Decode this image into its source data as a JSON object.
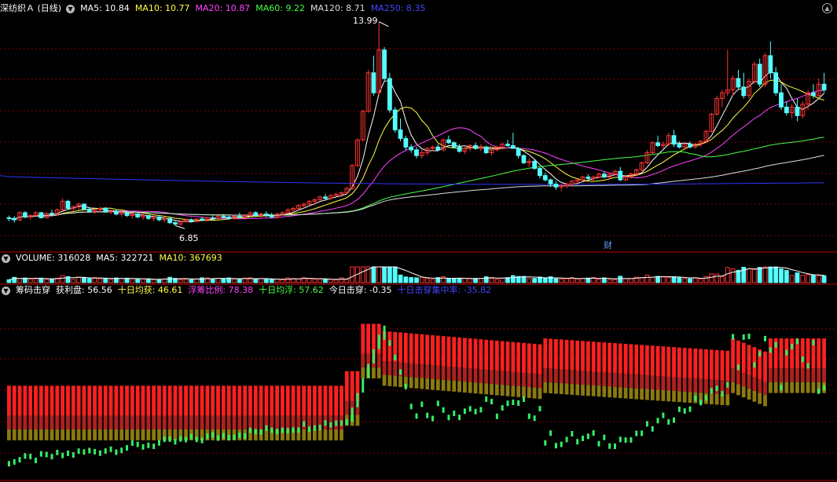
{
  "main": {
    "title": "深纺织Ａ (日线)",
    "ma": [
      {
        "label": "MA5: 10.84",
        "color": "#ffffff"
      },
      {
        "label": "MA10: 10.77",
        "color": "#ffff44"
      },
      {
        "label": "MA20: 10.87",
        "color": "#ff44ff"
      },
      {
        "label": "MA60: 9.22",
        "color": "#44ff44"
      },
      {
        "label": "MA120: 8.71",
        "color": "#dddddd"
      },
      {
        "label": "MA250: 8.35",
        "color": "#4444ff"
      }
    ],
    "high_label": "13.99",
    "low_label": "6.85",
    "finance_marker": "财",
    "candles": [
      [
        7.12,
        7.2,
        7.0,
        7.1
      ],
      [
        7.1,
        7.18,
        6.95,
        7.05
      ],
      [
        7.05,
        7.35,
        7.0,
        7.3
      ],
      [
        7.3,
        7.35,
        7.1,
        7.15
      ],
      [
        7.15,
        7.25,
        7.05,
        7.2
      ],
      [
        7.2,
        7.35,
        7.15,
        7.3
      ],
      [
        7.3,
        7.32,
        7.1,
        7.12
      ],
      [
        7.12,
        7.3,
        7.1,
        7.28
      ],
      [
        7.28,
        7.4,
        7.2,
        7.25
      ],
      [
        7.25,
        7.45,
        7.2,
        7.4
      ],
      [
        7.4,
        7.8,
        7.35,
        7.7
      ],
      [
        7.7,
        7.75,
        7.4,
        7.45
      ],
      [
        7.45,
        7.55,
        7.35,
        7.5
      ],
      [
        7.5,
        7.65,
        7.4,
        7.6
      ],
      [
        7.6,
        7.62,
        7.4,
        7.42
      ],
      [
        7.42,
        7.5,
        7.3,
        7.35
      ],
      [
        7.35,
        7.45,
        7.25,
        7.4
      ],
      [
        7.4,
        7.5,
        7.3,
        7.45
      ],
      [
        7.45,
        7.5,
        7.3,
        7.32
      ],
      [
        7.32,
        7.4,
        7.25,
        7.35
      ],
      [
        7.35,
        7.4,
        7.2,
        7.25
      ],
      [
        7.25,
        7.35,
        7.15,
        7.3
      ],
      [
        7.3,
        7.35,
        7.15,
        7.2
      ],
      [
        7.2,
        7.3,
        7.1,
        7.25
      ],
      [
        7.25,
        7.3,
        7.1,
        7.15
      ],
      [
        7.15,
        7.25,
        7.05,
        7.2
      ],
      [
        7.2,
        7.22,
        7.05,
        7.1
      ],
      [
        7.1,
        7.2,
        7.0,
        7.15
      ],
      [
        7.15,
        7.18,
        7.0,
        7.05
      ],
      [
        7.05,
        7.15,
        6.95,
        7.1
      ],
      [
        7.1,
        7.12,
        6.9,
        6.95
      ],
      [
        6.95,
        7.0,
        6.85,
        6.9
      ],
      [
        6.9,
        7.0,
        6.85,
        6.98
      ],
      [
        6.98,
        7.1,
        6.95,
        7.05
      ],
      [
        7.05,
        7.1,
        6.95,
        7.0
      ],
      [
        7.0,
        7.1,
        6.95,
        7.08
      ],
      [
        7.08,
        7.15,
        7.0,
        7.05
      ],
      [
        7.05,
        7.15,
        7.0,
        7.12
      ],
      [
        7.12,
        7.2,
        7.05,
        7.1
      ],
      [
        7.1,
        7.2,
        7.05,
        7.18
      ],
      [
        7.18,
        7.25,
        7.1,
        7.15
      ],
      [
        7.15,
        7.2,
        7.05,
        7.1
      ],
      [
        7.1,
        7.2,
        7.05,
        7.18
      ],
      [
        7.18,
        7.3,
        7.1,
        7.15
      ],
      [
        7.15,
        7.25,
        7.05,
        7.2
      ],
      [
        7.2,
        7.35,
        7.15,
        7.3
      ],
      [
        7.3,
        7.35,
        7.15,
        7.2
      ],
      [
        7.2,
        7.3,
        7.1,
        7.25
      ],
      [
        7.25,
        7.35,
        7.15,
        7.2
      ],
      [
        7.2,
        7.3,
        7.1,
        7.15
      ],
      [
        7.15,
        7.3,
        7.1,
        7.25
      ],
      [
        7.25,
        7.35,
        7.2,
        7.3
      ],
      [
        7.3,
        7.45,
        7.25,
        7.4
      ],
      [
        7.4,
        7.5,
        7.3,
        7.45
      ],
      [
        7.45,
        7.6,
        7.4,
        7.55
      ],
      [
        7.55,
        7.65,
        7.45,
        7.6
      ],
      [
        7.6,
        7.75,
        7.55,
        7.7
      ],
      [
        7.7,
        7.8,
        7.6,
        7.75
      ],
      [
        7.75,
        7.9,
        7.7,
        7.85
      ],
      [
        7.85,
        7.95,
        7.75,
        7.8
      ],
      [
        7.8,
        7.95,
        7.75,
        7.9
      ],
      [
        7.9,
        8.0,
        7.85,
        7.95
      ],
      [
        7.95,
        8.05,
        7.85,
        8.0
      ],
      [
        8.0,
        8.2,
        7.95,
        8.15
      ],
      [
        8.15,
        9.0,
        8.1,
        8.95
      ],
      [
        8.95,
        9.9,
        8.9,
        9.85
      ],
      [
        9.85,
        10.9,
        9.8,
        10.85
      ],
      [
        10.85,
        12.3,
        10.8,
        12.2
      ],
      [
        12.2,
        12.8,
        11.4,
        11.5
      ],
      [
        11.5,
        13.99,
        11.4,
        13.0
      ],
      [
        13.0,
        13.1,
        11.9,
        12.0
      ],
      [
        12.0,
        12.2,
        10.8,
        10.9
      ],
      [
        10.9,
        11.0,
        10.1,
        10.2
      ],
      [
        10.2,
        10.6,
        9.8,
        9.9
      ],
      [
        9.9,
        10.0,
        9.5,
        9.6
      ],
      [
        9.6,
        9.7,
        9.4,
        9.5
      ],
      [
        9.5,
        9.6,
        9.2,
        9.3
      ],
      [
        9.3,
        9.5,
        9.2,
        9.4
      ],
      [
        9.4,
        9.6,
        9.3,
        9.55
      ],
      [
        9.55,
        9.65,
        9.45,
        9.6
      ],
      [
        9.6,
        9.7,
        9.45,
        9.5
      ],
      [
        9.5,
        9.9,
        9.45,
        9.85
      ],
      [
        9.85,
        10.0,
        9.7,
        9.75
      ],
      [
        9.75,
        9.8,
        9.55,
        9.6
      ],
      [
        9.6,
        9.7,
        9.4,
        9.45
      ],
      [
        9.45,
        9.6,
        9.35,
        9.55
      ],
      [
        9.55,
        9.7,
        9.45,
        9.65
      ],
      [
        9.65,
        9.75,
        9.5,
        9.55
      ],
      [
        9.55,
        9.7,
        9.45,
        9.6
      ],
      [
        9.6,
        9.65,
        9.35,
        9.4
      ],
      [
        9.4,
        9.55,
        9.3,
        9.5
      ],
      [
        9.5,
        9.65,
        9.45,
        9.6
      ],
      [
        9.6,
        9.75,
        9.5,
        9.7
      ],
      [
        9.7,
        9.85,
        9.6,
        9.65
      ],
      [
        9.65,
        10.1,
        9.6,
        9.55
      ],
      [
        9.55,
        9.6,
        9.2,
        9.3
      ],
      [
        9.3,
        9.35,
        9.0,
        9.05
      ],
      [
        9.05,
        9.2,
        8.9,
        9.1
      ],
      [
        9.1,
        9.15,
        8.8,
        8.85
      ],
      [
        8.85,
        8.9,
        8.5,
        8.6
      ],
      [
        8.6,
        8.7,
        8.4,
        8.45
      ],
      [
        8.45,
        8.5,
        8.2,
        8.3
      ],
      [
        8.3,
        8.4,
        8.1,
        8.2
      ],
      [
        8.2,
        8.3,
        8.05,
        8.25
      ],
      [
        8.25,
        8.35,
        8.15,
        8.3
      ],
      [
        8.3,
        8.45,
        8.25,
        8.4
      ],
      [
        8.4,
        8.5,
        8.3,
        8.45
      ],
      [
        8.45,
        8.6,
        8.4,
        8.55
      ],
      [
        8.55,
        8.65,
        8.45,
        8.5
      ],
      [
        8.5,
        8.6,
        8.4,
        8.55
      ],
      [
        8.55,
        8.7,
        8.5,
        8.65
      ],
      [
        8.65,
        8.75,
        8.5,
        8.55
      ],
      [
        8.55,
        8.7,
        8.5,
        8.65
      ],
      [
        8.65,
        8.8,
        8.6,
        8.75
      ],
      [
        8.75,
        8.9,
        8.4,
        8.45
      ],
      [
        8.45,
        8.6,
        8.4,
        8.55
      ],
      [
        8.55,
        8.7,
        8.5,
        8.65
      ],
      [
        8.65,
        8.85,
        8.6,
        8.8
      ],
      [
        8.8,
        9.1,
        8.75,
        9.05
      ],
      [
        9.05,
        9.5,
        9.0,
        9.4
      ],
      [
        9.4,
        9.8,
        9.35,
        9.75
      ],
      [
        9.75,
        10.0,
        9.6,
        9.65
      ],
      [
        9.65,
        9.8,
        9.55,
        9.7
      ],
      [
        9.7,
        10.1,
        9.65,
        10.0
      ],
      [
        10.0,
        10.2,
        9.6,
        9.7
      ],
      [
        9.7,
        9.8,
        9.55,
        9.6
      ],
      [
        9.6,
        9.75,
        9.5,
        9.7
      ],
      [
        9.7,
        9.8,
        9.55,
        9.6
      ],
      [
        9.6,
        9.75,
        9.55,
        9.7
      ],
      [
        9.7,
        9.85,
        9.6,
        9.8
      ],
      [
        9.8,
        10.2,
        9.75,
        10.15
      ],
      [
        10.15,
        10.8,
        10.1,
        10.75
      ],
      [
        10.75,
        11.4,
        10.7,
        11.3
      ],
      [
        11.3,
        11.6,
        11.0,
        11.5
      ],
      [
        11.5,
        13.0,
        11.4,
        11.6
      ],
      [
        11.6,
        12.1,
        11.4,
        12.0
      ],
      [
        12.0,
        12.3,
        11.6,
        11.7
      ],
      [
        11.7,
        12.2,
        11.3,
        11.4
      ],
      [
        11.4,
        12.0,
        11.3,
        11.9
      ],
      [
        11.9,
        12.6,
        11.8,
        12.5
      ],
      [
        12.5,
        12.7,
        11.7,
        11.8
      ],
      [
        11.8,
        12.9,
        11.7,
        12.8
      ],
      [
        12.8,
        13.3,
        12.0,
        12.2
      ],
      [
        12.2,
        12.4,
        11.4,
        11.5
      ],
      [
        11.5,
        11.8,
        10.9,
        11.0
      ],
      [
        11.0,
        11.2,
        10.7,
        10.8
      ],
      [
        10.8,
        11.1,
        10.6,
        11.0
      ],
      [
        11.0,
        11.3,
        10.5,
        10.7
      ],
      [
        10.7,
        11.2,
        10.6,
        11.1
      ],
      [
        11.1,
        11.6,
        10.9,
        11.5
      ],
      [
        11.5,
        11.8,
        11.3,
        11.4
      ],
      [
        11.4,
        12.0,
        11.3,
        11.8
      ],
      [
        11.8,
        12.2,
        11.5,
        11.6
      ]
    ]
  },
  "volume": {
    "label": "VOLUME: 316028",
    "ma5": "MA5: 322721",
    "ma10": "MA10: 367693"
  },
  "indicator": {
    "name": "筹码击穿",
    "items": [
      {
        "label": "获利盘: 56.56",
        "color": "#ffffff"
      },
      {
        "label": "十日均获: 46.61",
        "color": "#ffff44"
      },
      {
        "label": "浮筹比例: 78.38",
        "color": "#ff44ff"
      },
      {
        "label": "十日均浮: 57.62",
        "color": "#44ff44"
      },
      {
        "label": "今日击穿: -0.35",
        "color": "#ffffff"
      },
      {
        "label": "十日击穿集中率: -35.82",
        "color": "#4444ff"
      }
    ]
  },
  "colors": {
    "up": "#ff3333",
    "down": "#54ffff",
    "grid": "#800000",
    "border": "#c00000"
  }
}
